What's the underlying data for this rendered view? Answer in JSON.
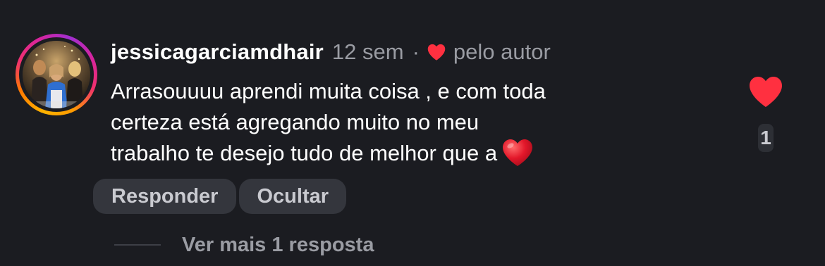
{
  "comment": {
    "username": "jessicagarciamdhair",
    "time": "12 sem",
    "separator": "·",
    "author_like_label": "pelo autor",
    "text_lines": [
      "Arrasouuuu aprendi muita coisa , e com toda",
      "certeza está agregando muito no meu",
      "trabalho te desejo tudo de melhor que a"
    ],
    "emoji": "red-heart-emoji",
    "actions": {
      "reply_label": "Responder",
      "hide_label": "Ocultar"
    },
    "more_replies_label": "Ver mais 1 resposta",
    "like_count": "1",
    "icons": {
      "author_heart": "heart-icon",
      "like": "heart-filled-icon"
    },
    "colors": {
      "background": "#1b1c21",
      "heart_red": "#ff3040",
      "muted_text": "#9a9ca3",
      "chip_bg": "#34363d"
    }
  }
}
